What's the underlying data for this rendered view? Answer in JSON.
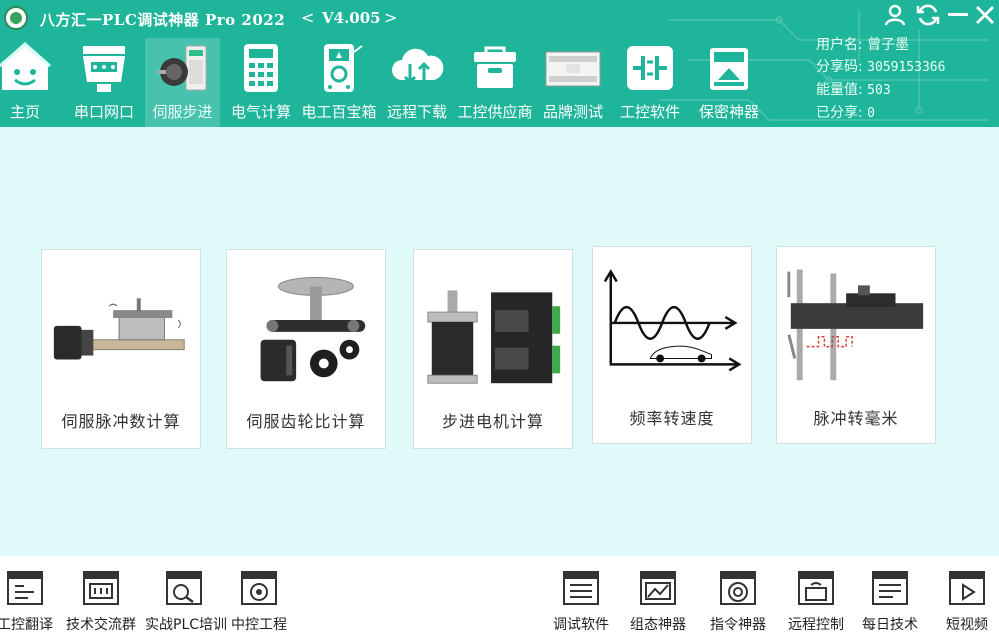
{
  "app": {
    "title": "八方汇一PLC调试神器 Pro 2022",
    "version_prev": "<",
    "version": "V4.005",
    "version_next": ">"
  },
  "nav": [
    {
      "label": "主页",
      "icon": "home-face-icon"
    },
    {
      "label": "串口网口",
      "icon": "serial-port-icon"
    },
    {
      "label": "伺服步进",
      "icon": "servo-motor-icon",
      "active": true
    },
    {
      "label": "电气计算",
      "icon": "calculator-icon"
    },
    {
      "label": "电工百宝箱",
      "icon": "multimeter-icon"
    },
    {
      "label": "远程下载",
      "icon": "cloud-transfer-icon"
    },
    {
      "label": "工控供应商",
      "icon": "supplier-box-icon"
    },
    {
      "label": "品牌测试",
      "icon": "plc-device-icon"
    },
    {
      "label": "工控软件",
      "icon": "ladder-contact-icon"
    },
    {
      "label": "保密神器",
      "icon": "secure-device-icon"
    }
  ],
  "user": {
    "username_label": "用户名:",
    "username": "曾子墨",
    "share_code_label": "分享码:",
    "share_code": "3059153366",
    "energy_label": "能量值:",
    "energy": "503",
    "shared_label": "已分享:",
    "shared": "0"
  },
  "cards": [
    {
      "label": "伺服脉冲数计算",
      "illus": "servo-linear-stage-illustration"
    },
    {
      "label": "伺服齿轮比计算",
      "illus": "servo-gear-illustration"
    },
    {
      "label": "步进电机计算",
      "illus": "stepper-motor-driver-illustration"
    },
    {
      "label": "频率转速度",
      "illus": "frequency-speed-chart-illustration"
    },
    {
      "label": "脉冲转毫米",
      "illus": "caliper-pulse-illustration"
    }
  ],
  "footer_left": [
    {
      "label": "工控翻译"
    },
    {
      "label": "技术交流群"
    },
    {
      "label": "实战PLC培训"
    },
    {
      "label": "中控工程"
    }
  ],
  "footer_right": [
    {
      "label": "调试软件"
    },
    {
      "label": "组态神器"
    },
    {
      "label": "指令神器"
    },
    {
      "label": "远程控制"
    },
    {
      "label": "每日技术"
    },
    {
      "label": "短视频"
    }
  ],
  "colors": {
    "header": "#1fb59a",
    "main_bg": "#dffaf8",
    "card_border": "#cfe2e2"
  }
}
